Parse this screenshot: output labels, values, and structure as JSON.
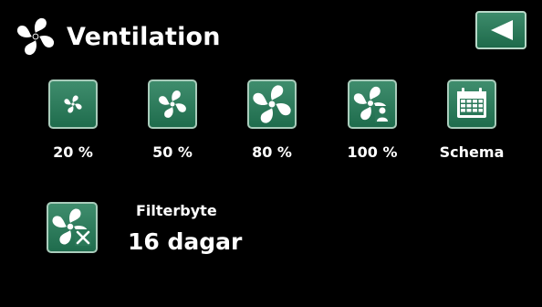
{
  "header": {
    "title": "Ventilation",
    "icon": "fan-icon"
  },
  "back_button": {
    "icon": "back-arrow-icon"
  },
  "speed_options": [
    {
      "label": "20 %",
      "icon": "fan-small-icon"
    },
    {
      "label": "50 %",
      "icon": "fan-medium-icon"
    },
    {
      "label": "80 %",
      "icon": "fan-large-icon"
    },
    {
      "label": "100 %",
      "icon": "fan-person-icon"
    },
    {
      "label": "Schema",
      "icon": "calendar-icon"
    }
  ],
  "filter": {
    "caption": "Filterbyte",
    "value": "16 dagar",
    "icon": "fan-tools-icon"
  },
  "colors": {
    "background": "#000000",
    "button_green": "#2f7d5d",
    "button_border": "#a9ccbb",
    "text": "#ffffff"
  }
}
